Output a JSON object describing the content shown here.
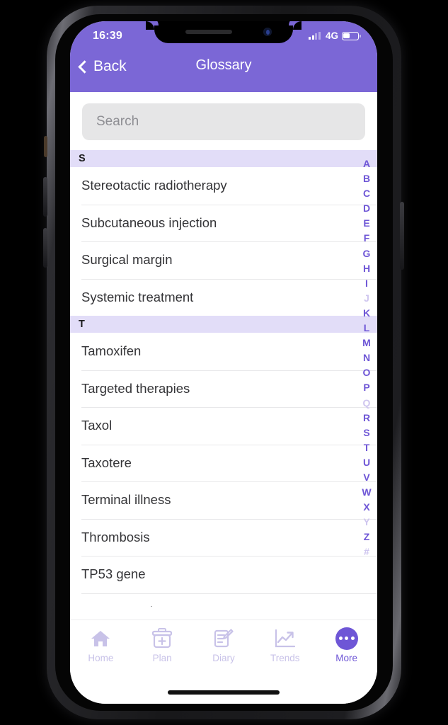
{
  "status_bar": {
    "time": "16:39",
    "network": "4G",
    "signal_bars_filled": 2,
    "signal_bars_total": 4,
    "battery_level_percent": 40
  },
  "nav": {
    "back_label": "Back",
    "title": "Glossary",
    "back_icon": "chevron-left-icon"
  },
  "search": {
    "placeholder": "Search",
    "value": ""
  },
  "colors": {
    "brand_purple": "#7b67d6",
    "index_purple": "#6e56d6",
    "section_header_bg": "#e2ddf8",
    "search_bg": "#e6e6e7",
    "tab_inactive": "#c8c2e8"
  },
  "list": {
    "sections": [
      {
        "letter": "S",
        "items": [
          "Stereotactic radiotherapy",
          "Subcutaneous injection",
          "Surgical margin",
          "Systemic treatment"
        ]
      },
      {
        "letter": "T",
        "items": [
          "Tamoxifen",
          "Targeted therapies",
          "Taxol",
          "Taxotere",
          "Terminal illness",
          "Thrombosis",
          "TP53 gene",
          "Trastuzumab"
        ]
      }
    ]
  },
  "index_strip": {
    "letters": [
      {
        "label": "A",
        "active": true
      },
      {
        "label": "B",
        "active": true
      },
      {
        "label": "C",
        "active": true
      },
      {
        "label": "D",
        "active": true
      },
      {
        "label": "E",
        "active": true
      },
      {
        "label": "F",
        "active": true
      },
      {
        "label": "G",
        "active": true
      },
      {
        "label": "H",
        "active": true
      },
      {
        "label": "I",
        "active": true
      },
      {
        "label": "J",
        "active": false
      },
      {
        "label": "K",
        "active": true
      },
      {
        "label": "L",
        "active": true
      },
      {
        "label": "M",
        "active": true
      },
      {
        "label": "N",
        "active": true
      },
      {
        "label": "O",
        "active": true
      },
      {
        "label": "P",
        "active": true
      },
      {
        "label": "Q",
        "active": false
      },
      {
        "label": "R",
        "active": true
      },
      {
        "label": "S",
        "active": true
      },
      {
        "label": "T",
        "active": true
      },
      {
        "label": "U",
        "active": true
      },
      {
        "label": "V",
        "active": true
      },
      {
        "label": "W",
        "active": true
      },
      {
        "label": "X",
        "active": true
      },
      {
        "label": "Y",
        "active": false
      },
      {
        "label": "Z",
        "active": true
      },
      {
        "label": "#",
        "active": false
      }
    ]
  },
  "tab_bar": {
    "tabs": [
      {
        "label": "Home",
        "icon": "home-icon",
        "active": false
      },
      {
        "label": "Plan",
        "icon": "calendar-plus-icon",
        "active": false
      },
      {
        "label": "Diary",
        "icon": "note-pencil-icon",
        "active": false
      },
      {
        "label": "Trends",
        "icon": "line-chart-icon",
        "active": false
      },
      {
        "label": "More",
        "icon": "ellipsis-icon",
        "active": true
      }
    ]
  }
}
